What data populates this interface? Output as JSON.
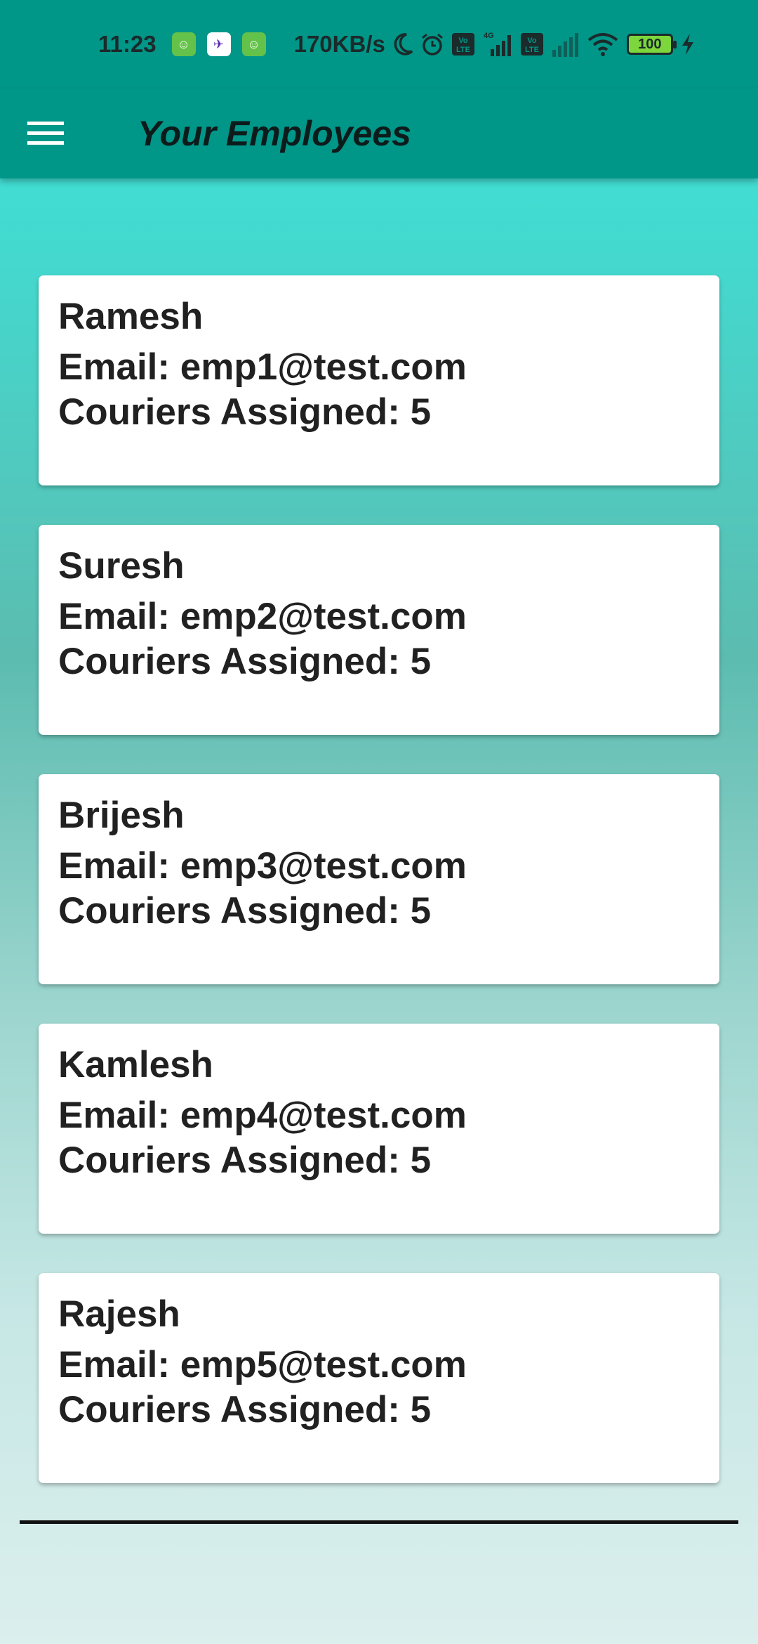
{
  "status_bar": {
    "time": "11:23",
    "speed": "170KB/s",
    "battery": "100",
    "icons": [
      "cat-app-icon",
      "delivery-app-icon",
      "cat-app-icon",
      "moon-icon",
      "alarm-icon",
      "volte-icon",
      "signal-4g-icon",
      "volte-icon",
      "signal-icon",
      "wifi-icon",
      "battery-icon",
      "charging-icon"
    ]
  },
  "app_bar": {
    "title": "Your Employees",
    "menu_icon": "hamburger-menu-icon"
  },
  "employees": [
    {
      "name": "Ramesh",
      "email": "Email: emp1@test.com",
      "couriers": "Couriers Assigned: 5"
    },
    {
      "name": "Suresh",
      "email": "Email: emp2@test.com",
      "couriers": "Couriers Assigned: 5"
    },
    {
      "name": "Brijesh",
      "email": "Email: emp3@test.com",
      "couriers": "Couriers Assigned: 5"
    },
    {
      "name": "Kamlesh",
      "email": "Email: emp4@test.com",
      "couriers": "Couriers Assigned: 5"
    },
    {
      "name": "Rajesh",
      "email": "Email: emp5@test.com",
      "couriers": "Couriers Assigned: 5"
    }
  ],
  "colors": {
    "app_bar": "#009688",
    "gradient_top": "#3ee8dd",
    "gradient_bottom": "#dbefed",
    "card": "#ffffff",
    "text": "#212121"
  }
}
